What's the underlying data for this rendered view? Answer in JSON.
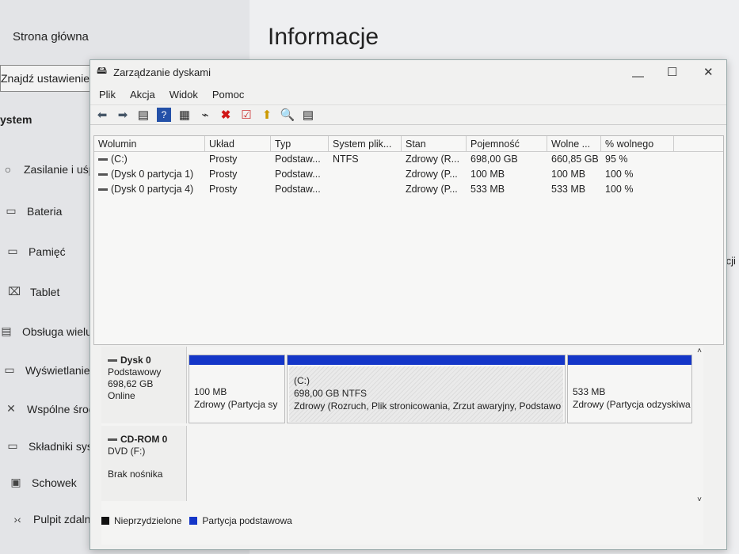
{
  "settings": {
    "home": "Strona główna",
    "search_placeholder": "Znajdź ustawienie",
    "section": "ystem",
    "page_title": "Informacje",
    "right_fragment": "ikacji",
    "nav": [
      {
        "icon": "power-icon",
        "label": "Zasilanie i uśp"
      },
      {
        "icon": "battery-icon",
        "label": "Bateria"
      },
      {
        "icon": "storage-icon",
        "label": "Pamięć"
      },
      {
        "icon": "tablet-icon",
        "label": "Tablet"
      },
      {
        "icon": "multitasking-icon",
        "label": "Obsługa wielu"
      },
      {
        "icon": "projecting-icon",
        "label": "Wyświetlanie r"
      },
      {
        "icon": "shared-experiences-icon",
        "label": "Wspólne środo"
      },
      {
        "icon": "system-components-icon",
        "label": "Składniki syste"
      },
      {
        "icon": "clipboard-icon",
        "label": "Schowek"
      },
      {
        "icon": "remote-desktop-icon",
        "label": "Pulpit zdalny"
      }
    ]
  },
  "window": {
    "title": "Zarządzanie dyskami",
    "menu": [
      "Plik",
      "Akcja",
      "Widok",
      "Pomoc"
    ]
  },
  "table": {
    "headers": [
      "Wolumin",
      "Układ",
      "Typ",
      "System plik...",
      "Stan",
      "Pojemność",
      "Wolne ...",
      "% wolnego"
    ],
    "rows": [
      [
        "(C:)",
        "Prosty",
        "Podstaw...",
        "NTFS",
        "Zdrowy (R...",
        "698,00 GB",
        "660,85 GB",
        "95 %"
      ],
      [
        "(Dysk 0 partycja 1)",
        "Prosty",
        "Podstaw...",
        "",
        "Zdrowy (P...",
        "100 MB",
        "100 MB",
        "100 %"
      ],
      [
        "(Dysk 0 partycja 4)",
        "Prosty",
        "Podstaw...",
        "",
        "Zdrowy (P...",
        "533 MB",
        "533 MB",
        "100 %"
      ]
    ]
  },
  "disks": [
    {
      "name": "Dysk 0",
      "type": "Podstawowy",
      "size": "698,62 GB",
      "status": "Online",
      "partitions": [
        {
          "label": "",
          "size": "100 MB",
          "status": "Zdrowy (Partycja sy"
        },
        {
          "label": "(C:)",
          "size": "698,00 GB NTFS",
          "status": "Zdrowy (Rozruch, Plik stronicowania, Zrzut awaryjny, Podstawo"
        },
        {
          "label": "",
          "size": "533 MB",
          "status": "Zdrowy (Partycja odzyskiwa"
        }
      ]
    },
    {
      "name": "CD-ROM 0",
      "type": "DVD (F:)",
      "status": "Brak nośnika"
    }
  ],
  "legend": [
    {
      "label": "Nieprzydzielone",
      "color": "#111111"
    },
    {
      "label": "Partycja podstawowa",
      "color": "#1436c8"
    }
  ]
}
